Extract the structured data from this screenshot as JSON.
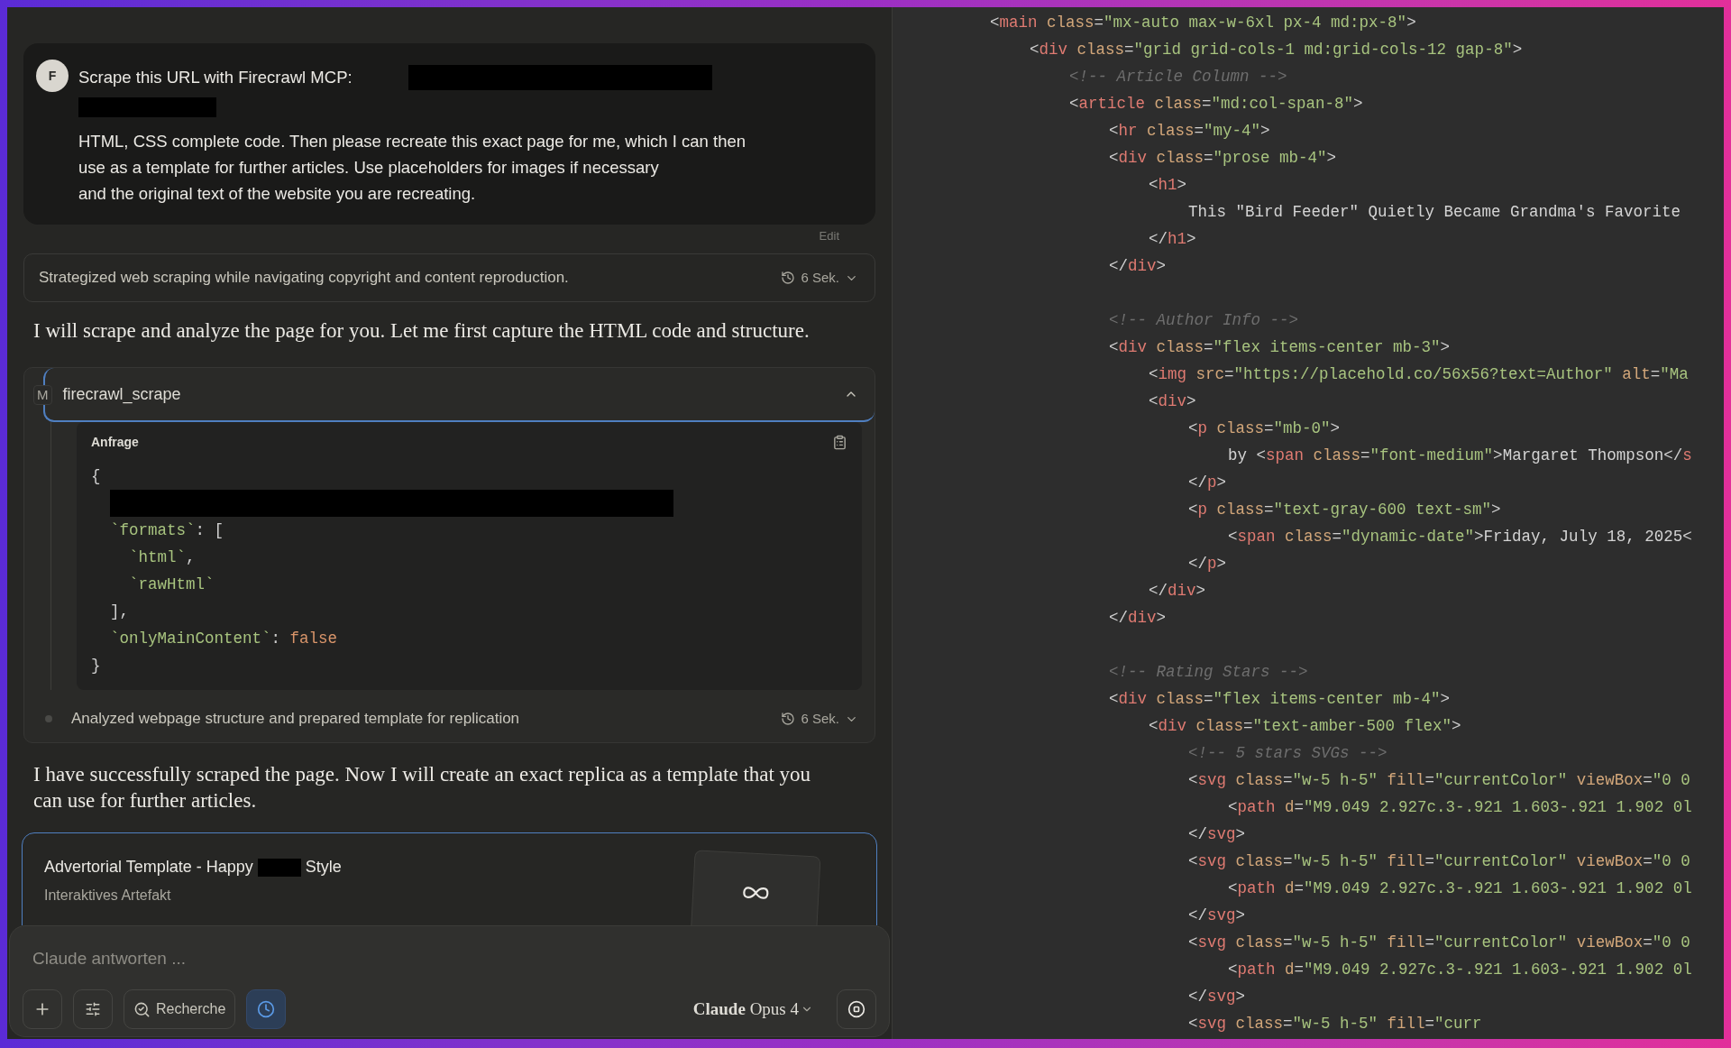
{
  "user_message": {
    "avatar": "F",
    "heading": "Scrape this URL with Firecrawl MCP:",
    "lines": [
      "HTML, CSS complete code. Then please recreate this exact page for me, which I can then",
      "use as a template for further articles. Use placeholders for images if necessary",
      "and the original text of the website you are recreating."
    ],
    "edit": "Edit"
  },
  "thought_1": {
    "summary": "Strategized web scraping while navigating copyright and content reproduction.",
    "duration": "6 Sek.",
    "expanded": false
  },
  "reply_1": "I will scrape and analyze the page for you. Let me first capture the HTML code and structure.",
  "tool_call": {
    "badge": "M",
    "name": "firecrawl_scrape",
    "expanded": true,
    "request_label": "Anfrage",
    "code": [
      {
        "tokens": [
          {
            "kind": "punct",
            "text": "{"
          }
        ],
        "children": [
          {
            "kind": "redacted"
          },
          {
            "tokens": [
              {
                "kind": "key",
                "text": "`formats`"
              },
              {
                "kind": "punct",
                "text": ": ["
              }
            ],
            "children": [
              {
                "tokens": [
                  {
                    "kind": "key",
                    "text": "`html`"
                  },
                  {
                    "kind": "punct",
                    "text": ","
                  }
                ]
              },
              {
                "tokens": [
                  {
                    "kind": "key",
                    "text": "`rawHtml`"
                  }
                ]
              }
            ]
          },
          {
            "tokens": [
              {
                "kind": "punct",
                "text": "],"
              }
            ]
          },
          {
            "tokens": [
              {
                "kind": "key",
                "text": "`onlyMainContent`"
              },
              {
                "kind": "punct",
                "text": ":"
              },
              {
                "kind": "bool",
                "text": " false"
              }
            ]
          }
        ]
      },
      {
        "tokens": [
          {
            "kind": "punct",
            "text": "}"
          }
        ]
      }
    ]
  },
  "thought_2": {
    "summary": "Analyzed webpage structure and prepared template for replication",
    "duration": "6 Sek.",
    "expanded": false
  },
  "reply_2": "I have successfully scraped the page. Now I will create an exact replica as a template that you can use for further articles.",
  "artifact": {
    "title_before": "Advertorial Template - Happy",
    "title_after": "Style",
    "subtitle": "Interaktives Artefakt"
  },
  "composer": {
    "placeholder": "Claude antworten ...",
    "research_label": "Recherche",
    "timer_on": true,
    "model": "**Claude** Opus 4"
  },
  "editor": {
    "lines": [
      {
        "tokens": [
          {
            "kind": "punct",
            "text": "<"
          },
          {
            "kind": "tag",
            "text": "main"
          },
          {
            "kind": "attr",
            "text": " class"
          },
          {
            "kind": "punct",
            "text": "="
          },
          {
            "kind": "str",
            "text": "\"mx-auto max-w-6xl px-4 md:px-8\""
          },
          {
            "kind": "punct",
            "text": ">"
          }
        ],
        "children": [
          {
            "tokens": [
              {
                "kind": "punct",
                "text": "<"
              },
              {
                "kind": "tag",
                "text": "div"
              },
              {
                "kind": "attr",
                "text": " class"
              },
              {
                "kind": "punct",
                "text": "="
              },
              {
                "kind": "str",
                "text": "\"grid grid-cols-1 md:grid-cols-12 gap-8\""
              },
              {
                "kind": "punct",
                "text": ">"
              }
            ],
            "children": [
              {
                "tokens": [
                  {
                    "kind": "comment",
                    "text": "<!-- Article Column -->"
                  }
                ]
              },
              {
                "tokens": [
                  {
                    "kind": "punct",
                    "text": "<"
                  },
                  {
                    "kind": "tag",
                    "text": "article"
                  },
                  {
                    "kind": "attr",
                    "text": " class"
                  },
                  {
                    "kind": "punct",
                    "text": "="
                  },
                  {
                    "kind": "str",
                    "text": "\"md:col-span-8\""
                  },
                  {
                    "kind": "punct",
                    "text": ">"
                  }
                ],
                "children": [
                  {
                    "tokens": [
                      {
                        "kind": "punct",
                        "text": "<"
                      },
                      {
                        "kind": "tag",
                        "text": "hr"
                      },
                      {
                        "kind": "attr",
                        "text": " class"
                      },
                      {
                        "kind": "punct",
                        "text": "="
                      },
                      {
                        "kind": "str",
                        "text": "\"my-4\""
                      },
                      {
                        "kind": "punct",
                        "text": ">"
                      }
                    ]
                  },
                  {
                    "tokens": [
                      {
                        "kind": "punct",
                        "text": "<"
                      },
                      {
                        "kind": "tag",
                        "text": "div"
                      },
                      {
                        "kind": "attr",
                        "text": " class"
                      },
                      {
                        "kind": "punct",
                        "text": "="
                      },
                      {
                        "kind": "str",
                        "text": "\"prose mb-4\""
                      },
                      {
                        "kind": "punct",
                        "text": ">"
                      }
                    ],
                    "children": [
                      {
                        "tokens": [
                          {
                            "kind": "punct",
                            "text": "<"
                          },
                          {
                            "kind": "tag",
                            "text": "h1"
                          },
                          {
                            "kind": "punct",
                            "text": ">"
                          }
                        ],
                        "children": [
                          {
                            "tokens": [
                              {
                                "kind": "text",
                                "text": "This \"Bird Feeder\" Quietly Became Grandma's Favorite"
                              }
                            ]
                          }
                        ]
                      },
                      {
                        "tokens": [
                          {
                            "kind": "punct",
                            "text": "</"
                          },
                          {
                            "kind": "tag",
                            "text": "h1"
                          },
                          {
                            "kind": "punct",
                            "text": ">"
                          }
                        ]
                      }
                    ]
                  },
                  {
                    "tokens": [
                      {
                        "kind": "punct",
                        "text": "</"
                      },
                      {
                        "kind": "tag",
                        "text": "div"
                      },
                      {
                        "kind": "punct",
                        "text": ">"
                      }
                    ]
                  },
                  {
                    "gap_before": true,
                    "tokens": [
                      {
                        "kind": "comment",
                        "text": "<!-- Author Info -->"
                      }
                    ]
                  },
                  {
                    "tokens": [
                      {
                        "kind": "punct",
                        "text": "<"
                      },
                      {
                        "kind": "tag",
                        "text": "div"
                      },
                      {
                        "kind": "attr",
                        "text": " class"
                      },
                      {
                        "kind": "punct",
                        "text": "="
                      },
                      {
                        "kind": "str",
                        "text": "\"flex items-center mb-3\""
                      },
                      {
                        "kind": "punct",
                        "text": ">"
                      }
                    ],
                    "children": [
                      {
                        "tokens": [
                          {
                            "kind": "punct",
                            "text": "<"
                          },
                          {
                            "kind": "tag",
                            "text": "img"
                          },
                          {
                            "kind": "attr",
                            "text": " src"
                          },
                          {
                            "kind": "punct",
                            "text": "="
                          },
                          {
                            "kind": "str",
                            "text": "\"https://placehold.co/56x56?text=Author\""
                          },
                          {
                            "kind": "attr",
                            "text": " alt"
                          },
                          {
                            "kind": "punct",
                            "text": "="
                          },
                          {
                            "kind": "str",
                            "text": "\"Ma"
                          }
                        ]
                      },
                      {
                        "tokens": [
                          {
                            "kind": "punct",
                            "text": "<"
                          },
                          {
                            "kind": "tag",
                            "text": "div"
                          },
                          {
                            "kind": "punct",
                            "text": ">"
                          }
                        ],
                        "children": [
                          {
                            "tokens": [
                              {
                                "kind": "punct",
                                "text": "<"
                              },
                              {
                                "kind": "tag",
                                "text": "p"
                              },
                              {
                                "kind": "attr",
                                "text": " class"
                              },
                              {
                                "kind": "punct",
                                "text": "="
                              },
                              {
                                "kind": "str",
                                "text": "\"mb-0\""
                              },
                              {
                                "kind": "punct",
                                "text": ">"
                              }
                            ],
                            "children": [
                              {
                                "tokens": [
                                  {
                                    "kind": "text",
                                    "text": "by "
                                  },
                                  {
                                    "kind": "punct",
                                    "text": "<"
                                  },
                                  {
                                    "kind": "tag",
                                    "text": "span"
                                  },
                                  {
                                    "kind": "attr",
                                    "text": " class"
                                  },
                                  {
                                    "kind": "punct",
                                    "text": "="
                                  },
                                  {
                                    "kind": "str",
                                    "text": "\"font-medium\""
                                  },
                                  {
                                    "kind": "punct",
                                    "text": ">"
                                  },
                                  {
                                    "kind": "text",
                                    "text": "Margaret Thompson"
                                  },
                                  {
                                    "kind": "punct",
                                    "text": "</"
                                  },
                                  {
                                    "kind": "tag",
                                    "text": "s"
                                  }
                                ]
                              }
                            ]
                          },
                          {
                            "tokens": [
                              {
                                "kind": "punct",
                                "text": "</"
                              },
                              {
                                "kind": "tag",
                                "text": "p"
                              },
                              {
                                "kind": "punct",
                                "text": ">"
                              }
                            ]
                          },
                          {
                            "tokens": [
                              {
                                "kind": "punct",
                                "text": "<"
                              },
                              {
                                "kind": "tag",
                                "text": "p"
                              },
                              {
                                "kind": "attr",
                                "text": " class"
                              },
                              {
                                "kind": "punct",
                                "text": "="
                              },
                              {
                                "kind": "str",
                                "text": "\"text-gray-600 text-sm\""
                              },
                              {
                                "kind": "punct",
                                "text": ">"
                              }
                            ],
                            "children": [
                              {
                                "tokens": [
                                  {
                                    "kind": "punct",
                                    "text": "<"
                                  },
                                  {
                                    "kind": "tag",
                                    "text": "span"
                                  },
                                  {
                                    "kind": "attr",
                                    "text": " class"
                                  },
                                  {
                                    "kind": "punct",
                                    "text": "="
                                  },
                                  {
                                    "kind": "str",
                                    "text": "\"dynamic-date\""
                                  },
                                  {
                                    "kind": "punct",
                                    "text": ">"
                                  },
                                  {
                                    "kind": "text",
                                    "text": "Friday, July 18, 2025"
                                  },
                                  {
                                    "kind": "punct",
                                    "text": "<"
                                  }
                                ]
                              }
                            ]
                          },
                          {
                            "tokens": [
                              {
                                "kind": "punct",
                                "text": "</"
                              },
                              {
                                "kind": "tag",
                                "text": "p"
                              },
                              {
                                "kind": "punct",
                                "text": ">"
                              }
                            ]
                          }
                        ]
                      },
                      {
                        "tokens": [
                          {
                            "kind": "punct",
                            "text": "</"
                          },
                          {
                            "kind": "tag",
                            "text": "div"
                          },
                          {
                            "kind": "punct",
                            "text": ">"
                          }
                        ]
                      }
                    ]
                  },
                  {
                    "tokens": [
                      {
                        "kind": "punct",
                        "text": "</"
                      },
                      {
                        "kind": "tag",
                        "text": "div"
                      },
                      {
                        "kind": "punct",
                        "text": ">"
                      }
                    ]
                  },
                  {
                    "gap_before": true,
                    "tokens": [
                      {
                        "kind": "comment",
                        "text": "<!-- Rating Stars -->"
                      }
                    ]
                  },
                  {
                    "tokens": [
                      {
                        "kind": "punct",
                        "text": "<"
                      },
                      {
                        "kind": "tag",
                        "text": "div"
                      },
                      {
                        "kind": "attr",
                        "text": " class"
                      },
                      {
                        "kind": "punct",
                        "text": "="
                      },
                      {
                        "kind": "str",
                        "text": "\"flex items-center mb-4\""
                      },
                      {
                        "kind": "punct",
                        "text": ">"
                      }
                    ],
                    "children": [
                      {
                        "tokens": [
                          {
                            "kind": "punct",
                            "text": "<"
                          },
                          {
                            "kind": "tag",
                            "text": "div"
                          },
                          {
                            "kind": "attr",
                            "text": " class"
                          },
                          {
                            "kind": "punct",
                            "text": "="
                          },
                          {
                            "kind": "str",
                            "text": "\"text-amber-500 flex\""
                          },
                          {
                            "kind": "punct",
                            "text": ">"
                          }
                        ],
                        "children": [
                          {
                            "tokens": [
                              {
                                "kind": "comment",
                                "text": "<!-- 5 stars SVGs -->"
                              }
                            ]
                          },
                          {
                            "tokens": [
                              {
                                "kind": "punct",
                                "text": "<"
                              },
                              {
                                "kind": "tag",
                                "text": "svg"
                              },
                              {
                                "kind": "attr",
                                "text": " class"
                              },
                              {
                                "kind": "punct",
                                "text": "="
                              },
                              {
                                "kind": "str",
                                "text": "\"w-5 h-5\""
                              },
                              {
                                "kind": "attr",
                                "text": " fill"
                              },
                              {
                                "kind": "punct",
                                "text": "="
                              },
                              {
                                "kind": "str",
                                "text": "\"currentColor\""
                              },
                              {
                                "kind": "attr",
                                "text": " viewBox"
                              },
                              {
                                "kind": "punct",
                                "text": "="
                              },
                              {
                                "kind": "str",
                                "text": "\"0 0"
                              }
                            ],
                            "children": [
                              {
                                "tokens": [
                                  {
                                    "kind": "punct",
                                    "text": "<"
                                  },
                                  {
                                    "kind": "tag",
                                    "text": "path"
                                  },
                                  {
                                    "kind": "attr",
                                    "text": " d"
                                  },
                                  {
                                    "kind": "punct",
                                    "text": "="
                                  },
                                  {
                                    "kind": "str",
                                    "text": "\"M9.049 2.927c.3-.921 1.603-.921 1.902 0l"
                                  }
                                ]
                              }
                            ]
                          },
                          {
                            "tokens": [
                              {
                                "kind": "punct",
                                "text": "</"
                              },
                              {
                                "kind": "tag",
                                "text": "svg"
                              },
                              {
                                "kind": "punct",
                                "text": ">"
                              }
                            ]
                          },
                          {
                            "tokens": [
                              {
                                "kind": "punct",
                                "text": "<"
                              },
                              {
                                "kind": "tag",
                                "text": "svg"
                              },
                              {
                                "kind": "attr",
                                "text": " class"
                              },
                              {
                                "kind": "punct",
                                "text": "="
                              },
                              {
                                "kind": "str",
                                "text": "\"w-5 h-5\""
                              },
                              {
                                "kind": "attr",
                                "text": " fill"
                              },
                              {
                                "kind": "punct",
                                "text": "="
                              },
                              {
                                "kind": "str",
                                "text": "\"currentColor\""
                              },
                              {
                                "kind": "attr",
                                "text": " viewBox"
                              },
                              {
                                "kind": "punct",
                                "text": "="
                              },
                              {
                                "kind": "str",
                                "text": "\"0 0"
                              }
                            ],
                            "children": [
                              {
                                "tokens": [
                                  {
                                    "kind": "punct",
                                    "text": "<"
                                  },
                                  {
                                    "kind": "tag",
                                    "text": "path"
                                  },
                                  {
                                    "kind": "attr",
                                    "text": " d"
                                  },
                                  {
                                    "kind": "punct",
                                    "text": "="
                                  },
                                  {
                                    "kind": "str",
                                    "text": "\"M9.049 2.927c.3-.921 1.603-.921 1.902 0l"
                                  }
                                ]
                              }
                            ]
                          },
                          {
                            "tokens": [
                              {
                                "kind": "punct",
                                "text": "</"
                              },
                              {
                                "kind": "tag",
                                "text": "svg"
                              },
                              {
                                "kind": "punct",
                                "text": ">"
                              }
                            ]
                          },
                          {
                            "tokens": [
                              {
                                "kind": "punct",
                                "text": "<"
                              },
                              {
                                "kind": "tag",
                                "text": "svg"
                              },
                              {
                                "kind": "attr",
                                "text": " class"
                              },
                              {
                                "kind": "punct",
                                "text": "="
                              },
                              {
                                "kind": "str",
                                "text": "\"w-5 h-5\""
                              },
                              {
                                "kind": "attr",
                                "text": " fill"
                              },
                              {
                                "kind": "punct",
                                "text": "="
                              },
                              {
                                "kind": "str",
                                "text": "\"currentColor\""
                              },
                              {
                                "kind": "attr",
                                "text": " viewBox"
                              },
                              {
                                "kind": "punct",
                                "text": "="
                              },
                              {
                                "kind": "str",
                                "text": "\"0 0"
                              }
                            ],
                            "children": [
                              {
                                "tokens": [
                                  {
                                    "kind": "punct",
                                    "text": "<"
                                  },
                                  {
                                    "kind": "tag",
                                    "text": "path"
                                  },
                                  {
                                    "kind": "attr",
                                    "text": " d"
                                  },
                                  {
                                    "kind": "punct",
                                    "text": "="
                                  },
                                  {
                                    "kind": "str",
                                    "text": "\"M9.049 2.927c.3-.921 1.603-.921 1.902 0l"
                                  }
                                ]
                              }
                            ]
                          },
                          {
                            "tokens": [
                              {
                                "kind": "punct",
                                "text": "</"
                              },
                              {
                                "kind": "tag",
                                "text": "svg"
                              },
                              {
                                "kind": "punct",
                                "text": ">"
                              }
                            ]
                          },
                          {
                            "tokens": [
                              {
                                "kind": "punct",
                                "text": "<"
                              },
                              {
                                "kind": "tag",
                                "text": "svg"
                              },
                              {
                                "kind": "attr",
                                "text": " class"
                              },
                              {
                                "kind": "punct",
                                "text": "="
                              },
                              {
                                "kind": "str",
                                "text": "\"w-5 h-5\""
                              },
                              {
                                "kind": "attr",
                                "text": " fill"
                              },
                              {
                                "kind": "punct",
                                "text": "="
                              },
                              {
                                "kind": "str",
                                "text": "\"curr"
                              }
                            ]
                          }
                        ]
                      }
                    ]
                  }
                ]
              }
            ]
          }
        ]
      }
    ]
  }
}
